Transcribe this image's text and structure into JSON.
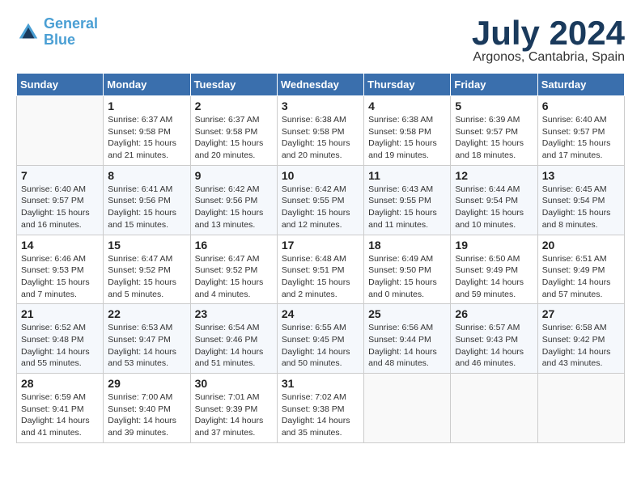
{
  "logo": {
    "line1": "General",
    "line2": "Blue"
  },
  "title": "July 2024",
  "subtitle": "Argonos, Cantabria, Spain",
  "weekdays": [
    "Sunday",
    "Monday",
    "Tuesday",
    "Wednesday",
    "Thursday",
    "Friday",
    "Saturday"
  ],
  "weeks": [
    [
      {
        "day": "",
        "info": ""
      },
      {
        "day": "1",
        "info": "Sunrise: 6:37 AM\nSunset: 9:58 PM\nDaylight: 15 hours\nand 21 minutes."
      },
      {
        "day": "2",
        "info": "Sunrise: 6:37 AM\nSunset: 9:58 PM\nDaylight: 15 hours\nand 20 minutes."
      },
      {
        "day": "3",
        "info": "Sunrise: 6:38 AM\nSunset: 9:58 PM\nDaylight: 15 hours\nand 20 minutes."
      },
      {
        "day": "4",
        "info": "Sunrise: 6:38 AM\nSunset: 9:58 PM\nDaylight: 15 hours\nand 19 minutes."
      },
      {
        "day": "5",
        "info": "Sunrise: 6:39 AM\nSunset: 9:57 PM\nDaylight: 15 hours\nand 18 minutes."
      },
      {
        "day": "6",
        "info": "Sunrise: 6:40 AM\nSunset: 9:57 PM\nDaylight: 15 hours\nand 17 minutes."
      }
    ],
    [
      {
        "day": "7",
        "info": "Sunrise: 6:40 AM\nSunset: 9:57 PM\nDaylight: 15 hours\nand 16 minutes."
      },
      {
        "day": "8",
        "info": "Sunrise: 6:41 AM\nSunset: 9:56 PM\nDaylight: 15 hours\nand 15 minutes."
      },
      {
        "day": "9",
        "info": "Sunrise: 6:42 AM\nSunset: 9:56 PM\nDaylight: 15 hours\nand 13 minutes."
      },
      {
        "day": "10",
        "info": "Sunrise: 6:42 AM\nSunset: 9:55 PM\nDaylight: 15 hours\nand 12 minutes."
      },
      {
        "day": "11",
        "info": "Sunrise: 6:43 AM\nSunset: 9:55 PM\nDaylight: 15 hours\nand 11 minutes."
      },
      {
        "day": "12",
        "info": "Sunrise: 6:44 AM\nSunset: 9:54 PM\nDaylight: 15 hours\nand 10 minutes."
      },
      {
        "day": "13",
        "info": "Sunrise: 6:45 AM\nSunset: 9:54 PM\nDaylight: 15 hours\nand 8 minutes."
      }
    ],
    [
      {
        "day": "14",
        "info": "Sunrise: 6:46 AM\nSunset: 9:53 PM\nDaylight: 15 hours\nand 7 minutes."
      },
      {
        "day": "15",
        "info": "Sunrise: 6:47 AM\nSunset: 9:52 PM\nDaylight: 15 hours\nand 5 minutes."
      },
      {
        "day": "16",
        "info": "Sunrise: 6:47 AM\nSunset: 9:52 PM\nDaylight: 15 hours\nand 4 minutes."
      },
      {
        "day": "17",
        "info": "Sunrise: 6:48 AM\nSunset: 9:51 PM\nDaylight: 15 hours\nand 2 minutes."
      },
      {
        "day": "18",
        "info": "Sunrise: 6:49 AM\nSunset: 9:50 PM\nDaylight: 15 hours\nand 0 minutes."
      },
      {
        "day": "19",
        "info": "Sunrise: 6:50 AM\nSunset: 9:49 PM\nDaylight: 14 hours\nand 59 minutes."
      },
      {
        "day": "20",
        "info": "Sunrise: 6:51 AM\nSunset: 9:49 PM\nDaylight: 14 hours\nand 57 minutes."
      }
    ],
    [
      {
        "day": "21",
        "info": "Sunrise: 6:52 AM\nSunset: 9:48 PM\nDaylight: 14 hours\nand 55 minutes."
      },
      {
        "day": "22",
        "info": "Sunrise: 6:53 AM\nSunset: 9:47 PM\nDaylight: 14 hours\nand 53 minutes."
      },
      {
        "day": "23",
        "info": "Sunrise: 6:54 AM\nSunset: 9:46 PM\nDaylight: 14 hours\nand 51 minutes."
      },
      {
        "day": "24",
        "info": "Sunrise: 6:55 AM\nSunset: 9:45 PM\nDaylight: 14 hours\nand 50 minutes."
      },
      {
        "day": "25",
        "info": "Sunrise: 6:56 AM\nSunset: 9:44 PM\nDaylight: 14 hours\nand 48 minutes."
      },
      {
        "day": "26",
        "info": "Sunrise: 6:57 AM\nSunset: 9:43 PM\nDaylight: 14 hours\nand 46 minutes."
      },
      {
        "day": "27",
        "info": "Sunrise: 6:58 AM\nSunset: 9:42 PM\nDaylight: 14 hours\nand 43 minutes."
      }
    ],
    [
      {
        "day": "28",
        "info": "Sunrise: 6:59 AM\nSunset: 9:41 PM\nDaylight: 14 hours\nand 41 minutes."
      },
      {
        "day": "29",
        "info": "Sunrise: 7:00 AM\nSunset: 9:40 PM\nDaylight: 14 hours\nand 39 minutes."
      },
      {
        "day": "30",
        "info": "Sunrise: 7:01 AM\nSunset: 9:39 PM\nDaylight: 14 hours\nand 37 minutes."
      },
      {
        "day": "31",
        "info": "Sunrise: 7:02 AM\nSunset: 9:38 PM\nDaylight: 14 hours\nand 35 minutes."
      },
      {
        "day": "",
        "info": ""
      },
      {
        "day": "",
        "info": ""
      },
      {
        "day": "",
        "info": ""
      }
    ]
  ]
}
